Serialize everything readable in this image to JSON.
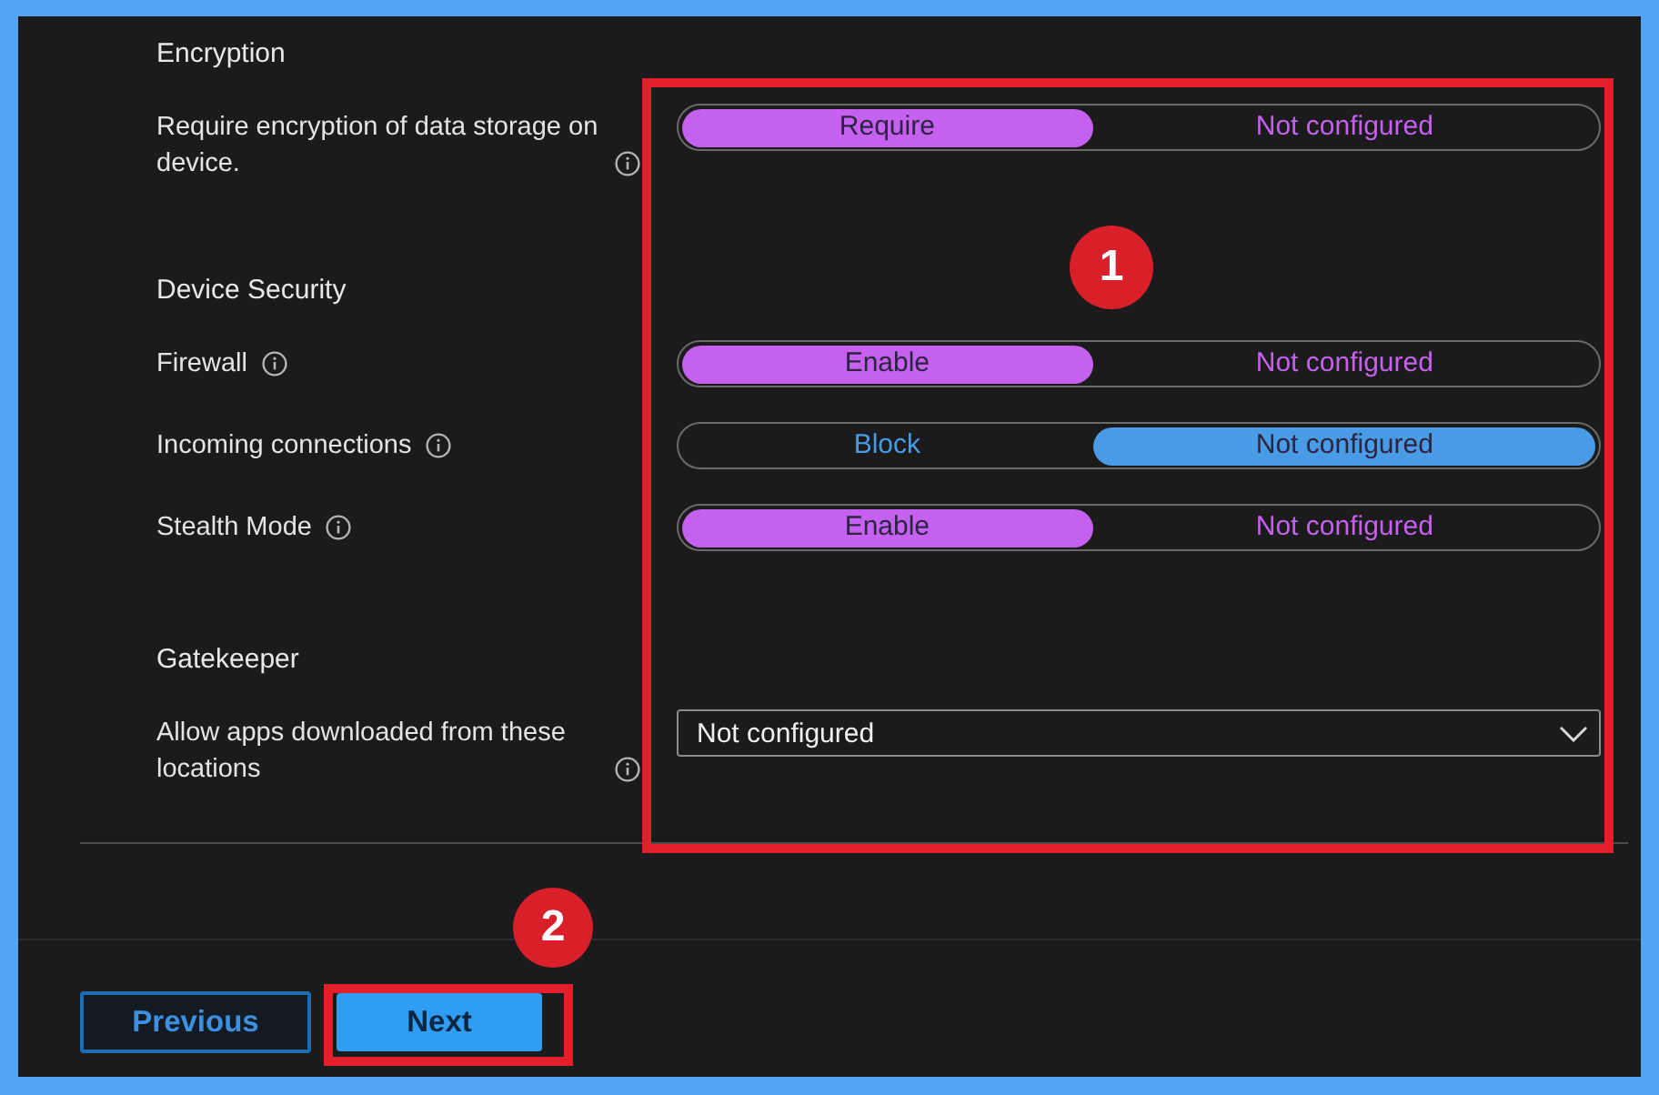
{
  "sections": [
    {
      "title": "Encryption",
      "settings": [
        {
          "kind": "toggle",
          "label": "Require encryption of data storage on device.",
          "color": "#c660f0",
          "options": [
            {
              "label": "Require",
              "selected": true
            },
            {
              "label": "Not configured",
              "selected": false
            }
          ]
        }
      ]
    },
    {
      "title": "Device Security",
      "settings": [
        {
          "kind": "toggle",
          "label": "Firewall",
          "color": "#c660f0",
          "options": [
            {
              "label": "Enable",
              "selected": true
            },
            {
              "label": "Not configured",
              "selected": false
            }
          ]
        },
        {
          "kind": "toggle",
          "label": "Incoming connections",
          "color": "#4a9be6",
          "options": [
            {
              "label": "Block",
              "selected": false
            },
            {
              "label": "Not configured",
              "selected": true
            }
          ]
        },
        {
          "kind": "toggle",
          "label": "Stealth Mode",
          "color": "#c660f0",
          "options": [
            {
              "label": "Enable",
              "selected": true
            },
            {
              "label": "Not configured",
              "selected": false
            }
          ]
        }
      ]
    },
    {
      "title": "Gatekeeper",
      "settings": [
        {
          "kind": "dropdown",
          "label": "Allow apps downloaded from these locations",
          "value": "Not configured"
        }
      ]
    }
  ],
  "buttons": [
    {
      "label": "Previous",
      "kind": "secondary"
    },
    {
      "label": "Next",
      "kind": "primary"
    }
  ],
  "callouts": [
    {
      "number": "1"
    },
    {
      "number": "2"
    }
  ]
}
